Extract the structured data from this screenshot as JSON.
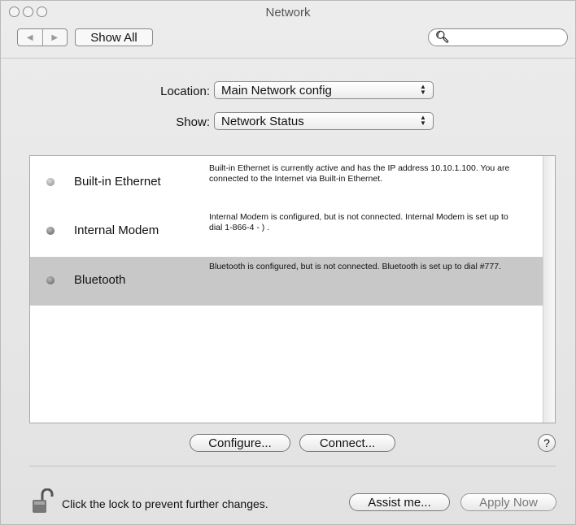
{
  "window": {
    "title": "Network"
  },
  "toolbar": {
    "back_icon": "back-arrow-icon",
    "forward_icon": "forward-arrow-icon",
    "show_all_label": "Show All",
    "search_icon": "magnifier-icon",
    "search_value": ""
  },
  "location": {
    "label": "Location:",
    "value": "Main Network config"
  },
  "show": {
    "label": "Show:",
    "value": "Network Status"
  },
  "services": [
    {
      "name": "Built-in Ethernet",
      "status_color": "#9a9a9a",
      "description": "Built-in Ethernet is currently active and has the IP address 10.10.1.100. You are connected to the Internet via Built-in Ethernet."
    },
    {
      "name": "Internal Modem",
      "status_color": "#5a5a5a",
      "description": "Internal Modem is configured, but is not connected. Internal Modem is set up to dial 1-866-4 - ) ."
    },
    {
      "name": "Bluetooth",
      "status_color": "#5a5a5a",
      "selected": true,
      "description": "Bluetooth is configured, but is not connected. Bluetooth is set up to dial #777."
    }
  ],
  "buttons": {
    "configure": "Configure...",
    "connect": "Connect...",
    "help": "?",
    "assist": "Assist me...",
    "apply": "Apply Now"
  },
  "lock": {
    "icon": "padlock-open-icon",
    "text": "Click the lock to prevent further changes."
  }
}
